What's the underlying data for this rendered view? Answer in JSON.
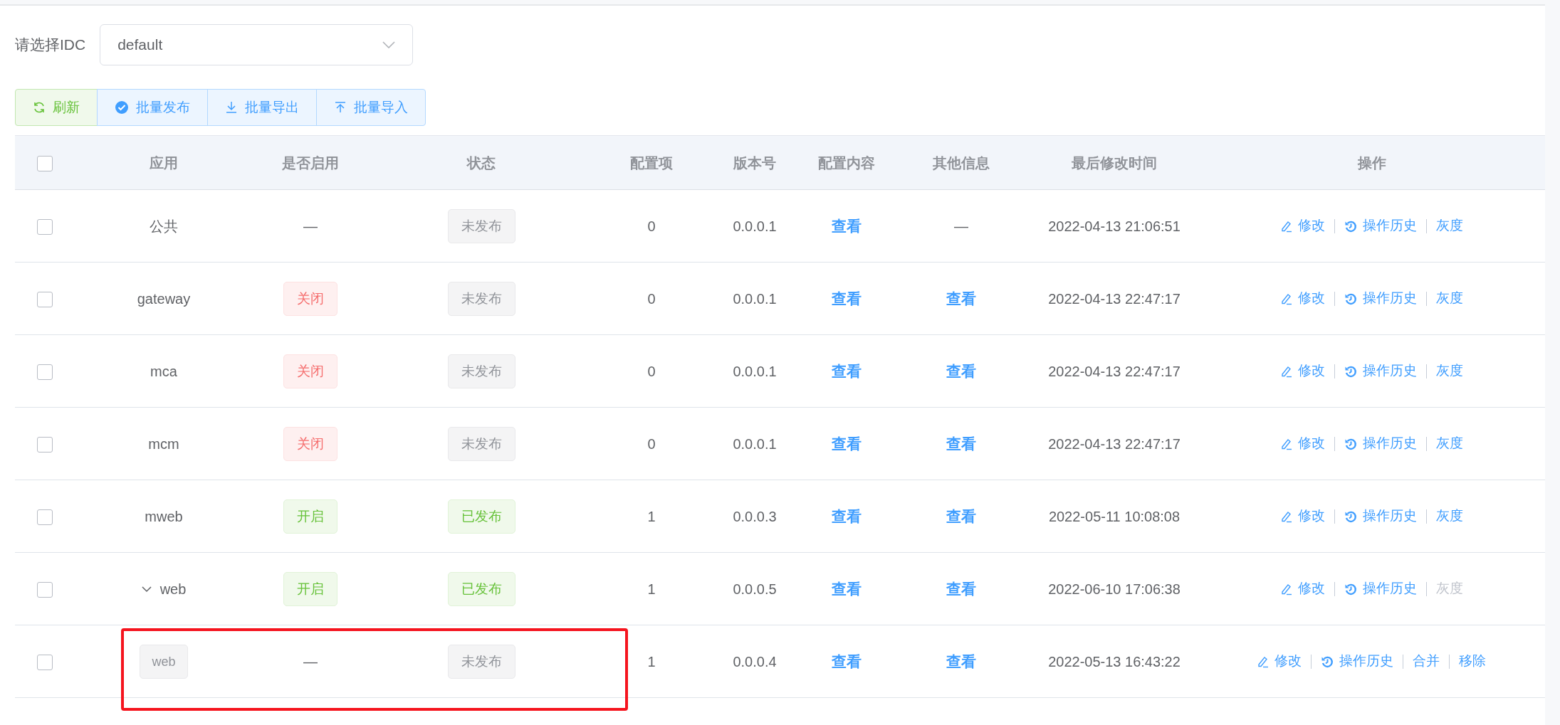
{
  "idc_selector": {
    "label": "请选择IDC",
    "value": "default"
  },
  "toolbar": [
    {
      "label": "刷新",
      "kind": "refresh"
    },
    {
      "label": "批量发布",
      "kind": "publish"
    },
    {
      "label": "批量导出",
      "kind": "export"
    },
    {
      "label": "批量导入",
      "kind": "import"
    }
  ],
  "table": {
    "select_all": {
      "checked": false
    },
    "columns": [
      "应用",
      "是否启用",
      "状态",
      "配置项",
      "版本号",
      "配置内容",
      "其他信息",
      "最后修改时间",
      "操作"
    ],
    "rows": [
      {
        "checked": false,
        "highlighted": false,
        "app": {
          "kind": "plain",
          "text": "公共"
        },
        "enabled": {
          "kind": "dash",
          "text": "—"
        },
        "status": {
          "kind": "unpublished",
          "text": "未发布"
        },
        "config_items": "0",
        "version": "0.0.0.1",
        "config_content": "查看",
        "other_info": {
          "kind": "dash",
          "text": "—"
        },
        "modified": "2022-04-13 21:06:51",
        "actions": [
          {
            "kind": "edit",
            "label": "修改",
            "disabled": false
          },
          {
            "kind": "history",
            "label": "操作历史",
            "disabled": false
          },
          {
            "kind": "plain",
            "label": "灰度",
            "disabled": false
          }
        ]
      },
      {
        "checked": false,
        "highlighted": false,
        "app": {
          "kind": "plain",
          "text": "gateway"
        },
        "enabled": {
          "kind": "off",
          "text": "关闭"
        },
        "status": {
          "kind": "unpublished",
          "text": "未发布"
        },
        "config_items": "0",
        "version": "0.0.0.1",
        "config_content": "查看",
        "other_info": {
          "kind": "link",
          "text": "查看"
        },
        "modified": "2022-04-13 22:47:17",
        "actions": [
          {
            "kind": "edit",
            "label": "修改",
            "disabled": false
          },
          {
            "kind": "history",
            "label": "操作历史",
            "disabled": false
          },
          {
            "kind": "plain",
            "label": "灰度",
            "disabled": false
          }
        ]
      },
      {
        "checked": false,
        "highlighted": false,
        "app": {
          "kind": "plain",
          "text": "mca"
        },
        "enabled": {
          "kind": "off",
          "text": "关闭"
        },
        "status": {
          "kind": "unpublished",
          "text": "未发布"
        },
        "config_items": "0",
        "version": "0.0.0.1",
        "config_content": "查看",
        "other_info": {
          "kind": "link",
          "text": "查看"
        },
        "modified": "2022-04-13 22:47:17",
        "actions": [
          {
            "kind": "edit",
            "label": "修改",
            "disabled": false
          },
          {
            "kind": "history",
            "label": "操作历史",
            "disabled": false
          },
          {
            "kind": "plain",
            "label": "灰度",
            "disabled": false
          }
        ]
      },
      {
        "checked": false,
        "highlighted": false,
        "app": {
          "kind": "plain",
          "text": "mcm"
        },
        "enabled": {
          "kind": "off",
          "text": "关闭"
        },
        "status": {
          "kind": "unpublished",
          "text": "未发布"
        },
        "config_items": "0",
        "version": "0.0.0.1",
        "config_content": "查看",
        "other_info": {
          "kind": "link",
          "text": "查看"
        },
        "modified": "2022-04-13 22:47:17",
        "actions": [
          {
            "kind": "edit",
            "label": "修改",
            "disabled": false
          },
          {
            "kind": "history",
            "label": "操作历史",
            "disabled": false
          },
          {
            "kind": "plain",
            "label": "灰度",
            "disabled": false
          }
        ]
      },
      {
        "checked": false,
        "highlighted": false,
        "app": {
          "kind": "plain",
          "text": "mweb"
        },
        "enabled": {
          "kind": "on",
          "text": "开启"
        },
        "status": {
          "kind": "published",
          "text": "已发布"
        },
        "config_items": "1",
        "version": "0.0.0.3",
        "config_content": "查看",
        "other_info": {
          "kind": "link",
          "text": "查看"
        },
        "modified": "2022-05-11 10:08:08",
        "actions": [
          {
            "kind": "edit",
            "label": "修改",
            "disabled": false
          },
          {
            "kind": "history",
            "label": "操作历史",
            "disabled": false
          },
          {
            "kind": "plain",
            "label": "灰度",
            "disabled": false
          }
        ]
      },
      {
        "checked": false,
        "highlighted": false,
        "app": {
          "kind": "parent",
          "text": "web",
          "expanded": true
        },
        "enabled": {
          "kind": "on",
          "text": "开启"
        },
        "status": {
          "kind": "published",
          "text": "已发布"
        },
        "config_items": "1",
        "version": "0.0.0.5",
        "config_content": "查看",
        "other_info": {
          "kind": "link",
          "text": "查看"
        },
        "modified": "2022-06-10 17:06:38",
        "actions": [
          {
            "kind": "edit",
            "label": "修改",
            "disabled": false
          },
          {
            "kind": "history",
            "label": "操作历史",
            "disabled": false
          },
          {
            "kind": "plain",
            "label": "灰度",
            "disabled": true
          }
        ]
      },
      {
        "checked": false,
        "highlighted": true,
        "app": {
          "kind": "child",
          "text": "web"
        },
        "enabled": {
          "kind": "dash",
          "text": "—"
        },
        "status": {
          "kind": "unpublished",
          "text": "未发布"
        },
        "config_items": "1",
        "version": "0.0.0.4",
        "config_content": "查看",
        "other_info": {
          "kind": "link",
          "text": "查看"
        },
        "modified": "2022-05-13 16:43:22",
        "actions": [
          {
            "kind": "edit",
            "label": "修改",
            "disabled": false
          },
          {
            "kind": "history",
            "label": "操作历史",
            "disabled": false
          },
          {
            "kind": "plain",
            "label": "合并",
            "disabled": false
          },
          {
            "kind": "plain",
            "label": "移除",
            "disabled": false
          }
        ]
      }
    ]
  }
}
